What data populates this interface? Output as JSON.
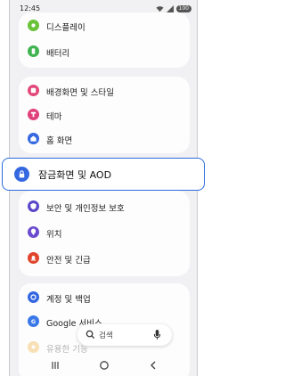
{
  "status_bar": {
    "time": "12:45",
    "battery": "100"
  },
  "settings": {
    "group1": [
      {
        "label": "디스플레이",
        "icon": "sun-icon",
        "color": "#6ac23a"
      },
      {
        "label": "배터리",
        "icon": "battery-icon",
        "color": "#3fb34f"
      }
    ],
    "group2": [
      {
        "label": "배경화면 및 스타일",
        "icon": "palette-icon",
        "color": "#e2497a"
      },
      {
        "label": "테마",
        "icon": "theme-icon",
        "color": "#e0417a"
      },
      {
        "label": "홈 화면",
        "icon": "home-icon",
        "color": "#3467e0"
      }
    ],
    "highlighted": {
      "label": "잠금화면 및 AOD",
      "icon": "lock-icon",
      "color": "#3467e0"
    },
    "group3": [
      {
        "label": "보안 및 개인정보 보호",
        "icon": "shield-icon",
        "color": "#5a48c9"
      },
      {
        "label": "위치",
        "icon": "location-icon",
        "color": "#6b4bcf"
      },
      {
        "label": "안전 및 긴급",
        "icon": "emergency-icon",
        "color": "#e0442c"
      }
    ],
    "group4": [
      {
        "label": "계정 및 백업",
        "icon": "sync-icon",
        "color": "#3467e0"
      },
      {
        "label": "Google 서비스",
        "icon": "google-icon",
        "color": "#3a78e8"
      },
      {
        "label": "유용한 기능",
        "icon": "star-icon",
        "color": "#f0a830"
      }
    ]
  },
  "search": {
    "placeholder": "검색"
  },
  "nav": {
    "recents": "recents-icon",
    "home": "home-button-icon",
    "back": "back-icon"
  }
}
